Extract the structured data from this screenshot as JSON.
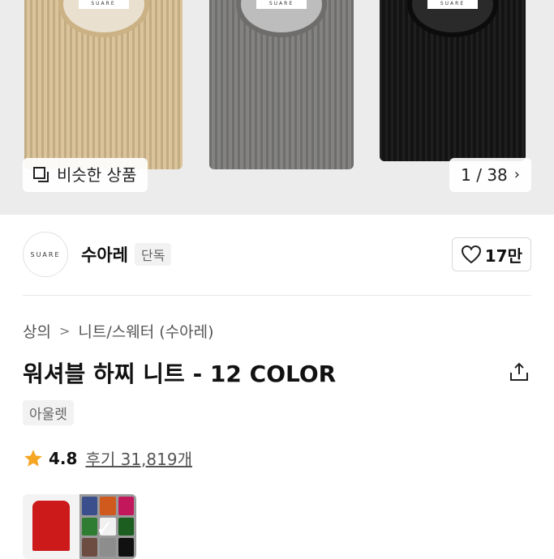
{
  "hero": {
    "brand_tag": "SUARE",
    "similar_label": "비슷한 상품",
    "image_counter": "1 / 38"
  },
  "store": {
    "logo_text": "SUARE",
    "name": "수아레",
    "badge": "단독",
    "likes": "17만"
  },
  "breadcrumb": {
    "category": "상의",
    "subcategory": "니트/스웨터 (수아레)"
  },
  "product": {
    "title": "워셔블 하찌 니트 - 12 COLOR",
    "outlet_badge": "아울렛"
  },
  "rating": {
    "score": "4.8",
    "reviews": "후기 31,819개",
    "star_color": "#f5a623"
  },
  "colors": {
    "sweater_beige": "#d8bf93",
    "sweater_gray": "#7b7a78",
    "sweater_black": "#131313",
    "swatches": [
      "#3a4f8c",
      "#d05a1e",
      "#c2185b",
      "#2e7d32",
      "#f0f0f0",
      "#1b5e20",
      "#6d4c41",
      "#8d8d8d",
      "#111111"
    ]
  },
  "icons": [
    "similar-items-icon",
    "chevron-right-icon",
    "heart-icon",
    "share-icon",
    "star-icon",
    "check-icon"
  ]
}
